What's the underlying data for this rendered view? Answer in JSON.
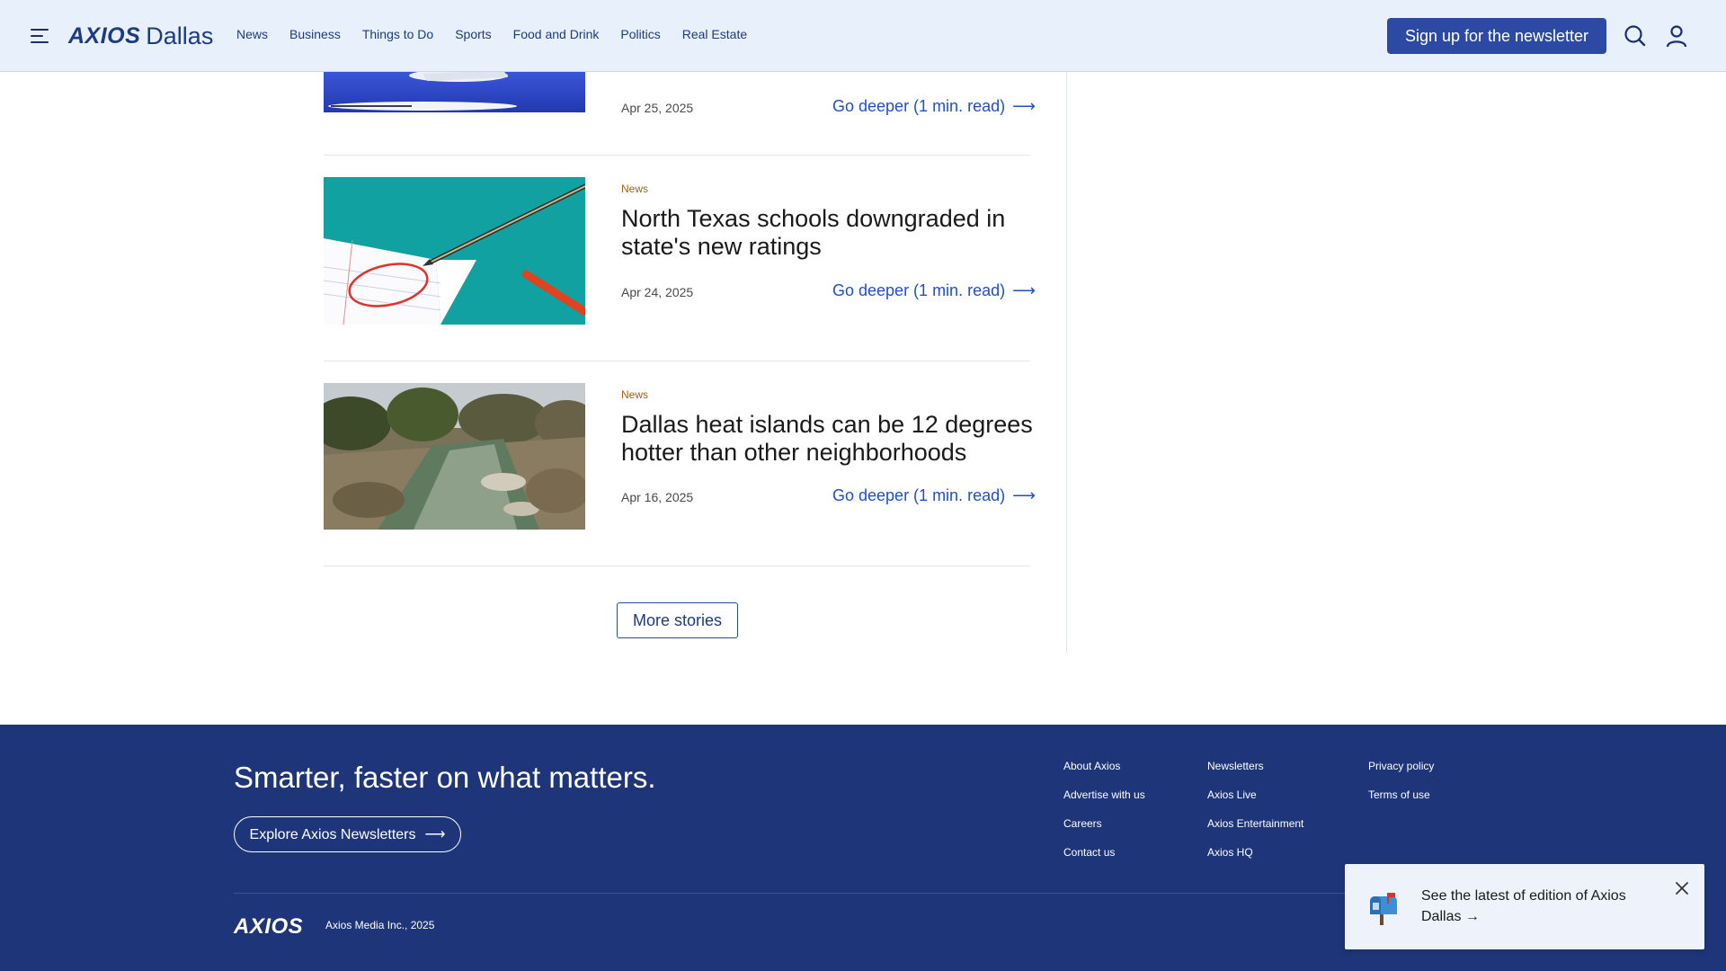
{
  "header": {
    "logo_mark": "AXIOS",
    "logo_city": "Dallas",
    "nav": [
      "News",
      "Business",
      "Things to Do",
      "Sports",
      "Food and Drink",
      "Politics",
      "Real Estate"
    ],
    "signup_label": "Sign up for the newsletter",
    "icons": [
      "menu-icon",
      "search-icon",
      "user-icon"
    ]
  },
  "articles": [
    {
      "category": "",
      "title": "",
      "date": "Apr 25, 2025",
      "link": "Go deeper (1 min. read)",
      "image": "airplane"
    },
    {
      "category": "News",
      "title": "North Texas schools downgraded in state's new ratings",
      "date": "Apr 24, 2025",
      "link": "Go deeper (1 min. read)",
      "image": "report card with pen, \"Needs work!\""
    },
    {
      "category": "News",
      "title": "Dallas heat islands can be 12 degrees hotter than other neighborhoods",
      "date": "Apr 16, 2025",
      "link": "Go deeper (1 min. read)",
      "image": "creek"
    }
  ],
  "arrow": "⟶",
  "more_stories": "More stories",
  "footer": {
    "tagline": "Smarter, faster on what matters.",
    "explore": "Explore Axios Newsletters",
    "col1": [
      "About Axios",
      "Advertise with us",
      "Careers",
      "Contact us"
    ],
    "col2": [
      "Newsletters",
      "Axios Live",
      "Axios Entertainment",
      "Axios HQ"
    ],
    "col3": [
      "Privacy policy",
      "Terms of use"
    ],
    "logo": "AXIOS",
    "copyright": "Axios Media Inc., 2025"
  },
  "toast": {
    "text": "See the latest of edition of Axios Dallas →",
    "icon": "mailbox-icon"
  },
  "colors": {
    "header_bg": "#e8f0fb",
    "brand_blue": "#1d3b82",
    "button_blue": "#2c4aa3",
    "link_blue": "#1f4fd0",
    "category_orange": "#a55f12",
    "footer_bg": "#1e3679"
  }
}
